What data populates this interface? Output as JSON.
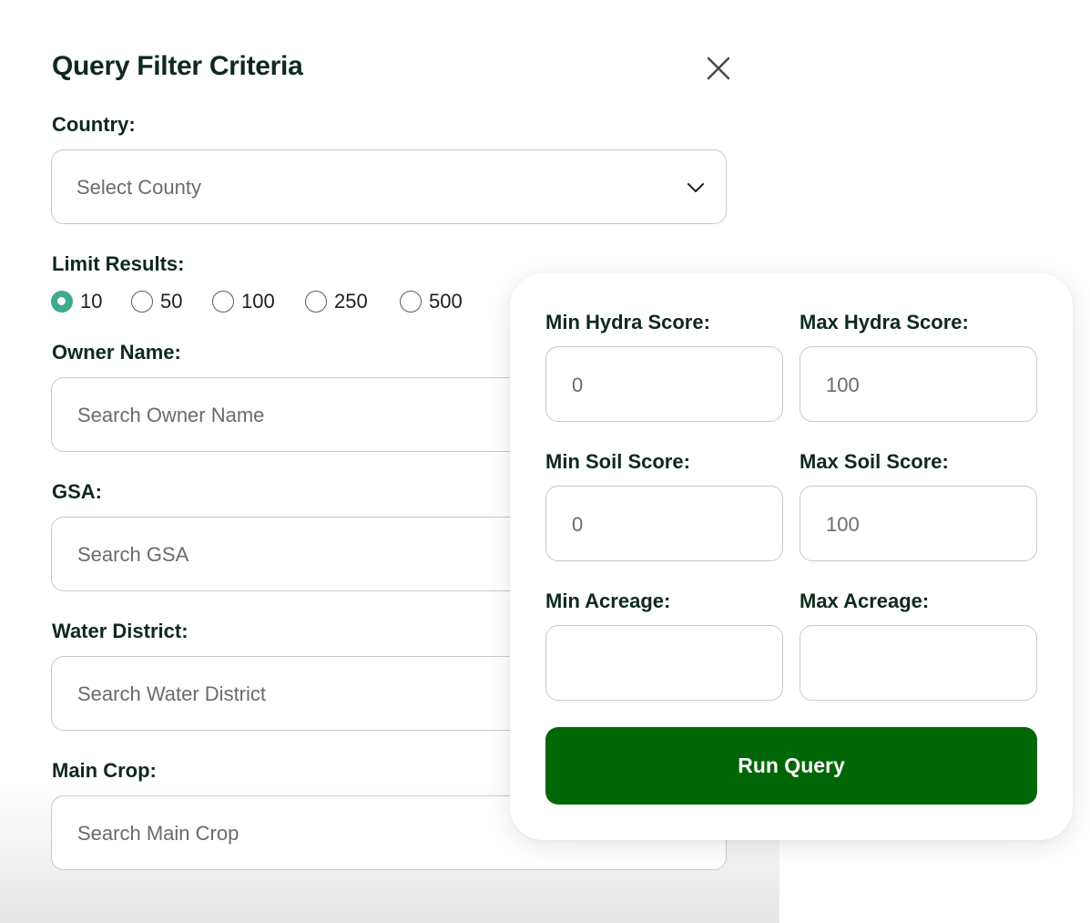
{
  "dialog": {
    "title": "Query Filter Criteria"
  },
  "country": {
    "label": "Country:",
    "selected": "Select County"
  },
  "limit": {
    "label": "Limit Results:",
    "options": [
      "10",
      "50",
      "100",
      "250",
      "500"
    ],
    "selected": "10"
  },
  "owner": {
    "label": "Owner Name:",
    "placeholder": "Search Owner Name"
  },
  "gsa": {
    "label": "GSA:",
    "placeholder": "Search GSA"
  },
  "water_district": {
    "label": "Water District:",
    "placeholder": "Search Water District"
  },
  "main_crop": {
    "label": "Main Crop:",
    "placeholder": "Search Main Crop"
  },
  "scores": {
    "min_hydra": {
      "label": "Min Hydra Score:",
      "placeholder": "0"
    },
    "max_hydra": {
      "label": "Max Hydra Score:",
      "placeholder": "100"
    },
    "min_soil": {
      "label": "Min Soil Score:",
      "placeholder": "0"
    },
    "max_soil": {
      "label": "Max Soil Score:",
      "placeholder": "100"
    },
    "min_acreage": {
      "label": "Min Acreage:",
      "placeholder": ""
    },
    "max_acreage": {
      "label": "Max Acreage:",
      "placeholder": ""
    }
  },
  "run_button": "Run Query",
  "colors": {
    "primary_button": "#016605",
    "radio_checked": "#3eaa8e",
    "text_dark": "#0d2a1c"
  },
  "icons": {
    "close": "close-icon",
    "dropdown": "chevron-down-icon"
  }
}
